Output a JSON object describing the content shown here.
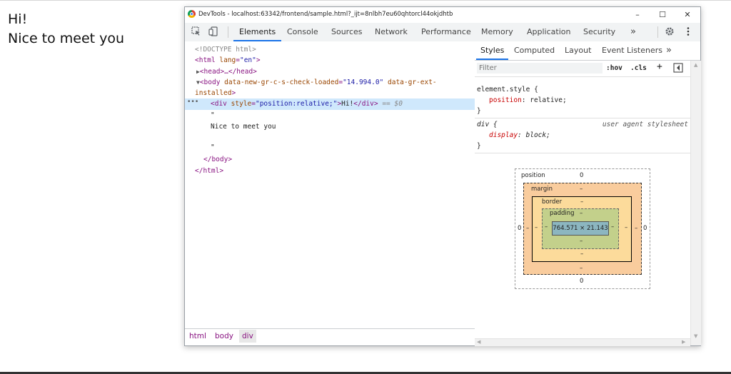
{
  "page": {
    "line1": "Hi!",
    "line2": "Nice to meet you"
  },
  "devtools": {
    "title": "DevTools - localhost:63342/frontend/sample.html?_ijt=8nlbh7eu60qhtorcl44okjdhtb",
    "window_buttons": [
      "–",
      "☐",
      "✕"
    ],
    "tabs": [
      "Elements",
      "Console",
      "Sources",
      "Network",
      "Performance",
      "Memory",
      "Application",
      "Security"
    ],
    "more_tabs": "»",
    "dom": {
      "doctype": "<!DOCTYPE html>",
      "html_open_tag": "<html",
      "html_lang_attr": "lang",
      "html_lang_val": "\"en\"",
      "head": "<head>…</head>",
      "body_tag": "<body",
      "body_attr1": "data-new-gr-c-s-check-loaded",
      "body_val1": "\"14.994.0\"",
      "body_attr2": "data-gr-ext-",
      "body_attr2b": "installed",
      "div_tag": "<div",
      "div_attr": "style",
      "div_val": "\"position:relative;\"",
      "div_text": "Hi!",
      "div_close": "</div>",
      "selected_marker": "== $0",
      "quote1": "\"",
      "text_node": "Nice to meet you",
      "quote2": "\"",
      "body_close": "</body>",
      "html_close": "</html>"
    },
    "breadcrumbs": [
      "html",
      "body",
      "div"
    ],
    "styles": {
      "subtabs": [
        "Styles",
        "Computed",
        "Layout",
        "Event Listeners"
      ],
      "more": "»",
      "filter_placeholder": "Filter",
      "hov": ":hov",
      "cls": ".cls",
      "plus": "+",
      "rule1_selector": "element.style {",
      "rule1_prop": "position",
      "rule1_value": "relative;",
      "rule_close": "}",
      "rule2_selector": "div {",
      "rule2_source": "user agent stylesheet",
      "rule2_prop": "display",
      "rule2_value": "block;"
    },
    "box_model": {
      "position_label": "position",
      "position_value": "0",
      "margin_label": "margin",
      "margin_value": "–",
      "border_label": "border",
      "border_value": "–",
      "padding_label": "padding",
      "padding_value": "–",
      "content": "764.571 × 21.143",
      "side_zero": "0",
      "dash": "–"
    }
  }
}
